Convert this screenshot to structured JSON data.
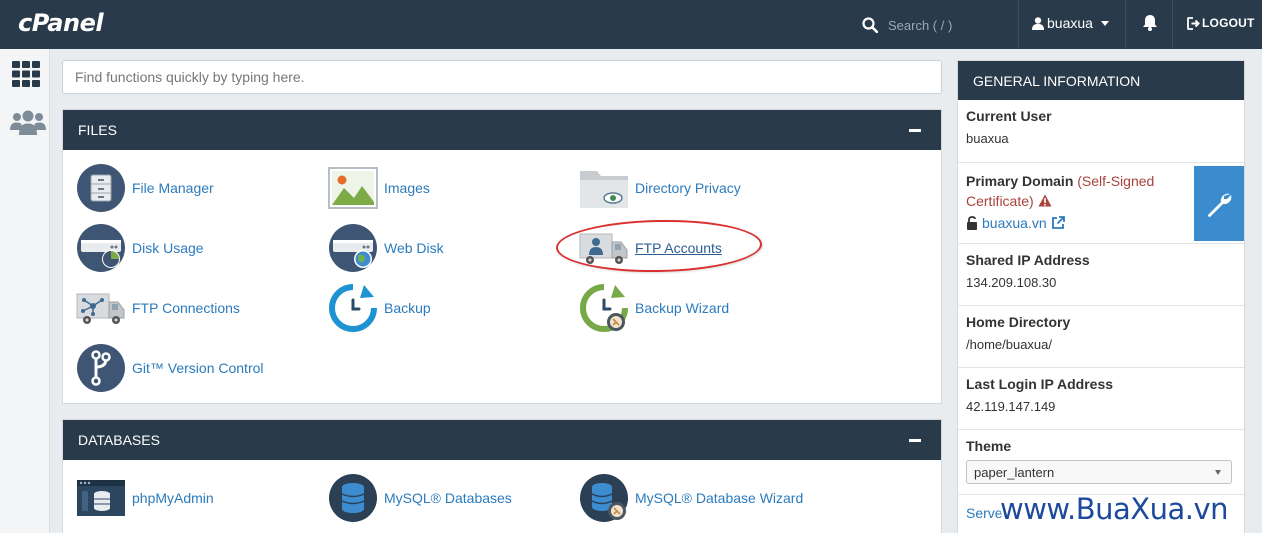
{
  "header": {
    "logo": "cPanel",
    "search_placeholder": "Search ( / )",
    "username": "buaxua",
    "logout_label": "LOGOUT"
  },
  "quick_find": {
    "placeholder": "Find functions quickly by typing here."
  },
  "files": {
    "title": "FILES",
    "items": [
      {
        "label": "File Manager",
        "icon": "file-manager-icon"
      },
      {
        "label": "Images",
        "icon": "images-icon"
      },
      {
        "label": "Directory Privacy",
        "icon": "directory-privacy-icon"
      },
      {
        "label": "Disk Usage",
        "icon": "disk-usage-icon"
      },
      {
        "label": "Web Disk",
        "icon": "web-disk-icon"
      },
      {
        "label": "FTP Accounts",
        "icon": "ftp-accounts-icon"
      },
      {
        "label": "FTP Connections",
        "icon": "ftp-connections-icon"
      },
      {
        "label": "Backup",
        "icon": "backup-icon"
      },
      {
        "label": "Backup Wizard",
        "icon": "backup-wizard-icon"
      },
      {
        "label": "Git™ Version Control",
        "icon": "git-icon"
      }
    ]
  },
  "databases": {
    "title": "DATABASES",
    "items": [
      {
        "label": "phpMyAdmin",
        "icon": "phpmyadmin-icon"
      },
      {
        "label": "MySQL® Databases",
        "icon": "mysql-databases-icon"
      },
      {
        "label": "MySQL® Database Wizard",
        "icon": "mysql-wizard-icon"
      }
    ]
  },
  "general_info": {
    "title": "GENERAL INFORMATION",
    "current_user_label": "Current User",
    "current_user": "buaxua",
    "primary_domain_label": "Primary Domain",
    "primary_domain_warning": "(Self-Signed Certificate)",
    "primary_domain": "buaxua.vn",
    "shared_ip_label": "Shared IP Address",
    "shared_ip": "134.209.108.30",
    "home_dir_label": "Home Directory",
    "home_dir": "/home/buaxua/",
    "last_login_label": "Last Login IP Address",
    "last_login_ip": "42.119.147.149",
    "theme_label": "Theme",
    "theme_value": "paper_lantern",
    "server_partial": "Serve"
  },
  "watermark": "www.BuaXua.vn",
  "colors": {
    "header_bg": "#293a4a",
    "link": "#2b7bbd",
    "highlight_oval": "#d8312f",
    "accent_blue": "#3a8ccf",
    "warning": "#a9423b"
  }
}
